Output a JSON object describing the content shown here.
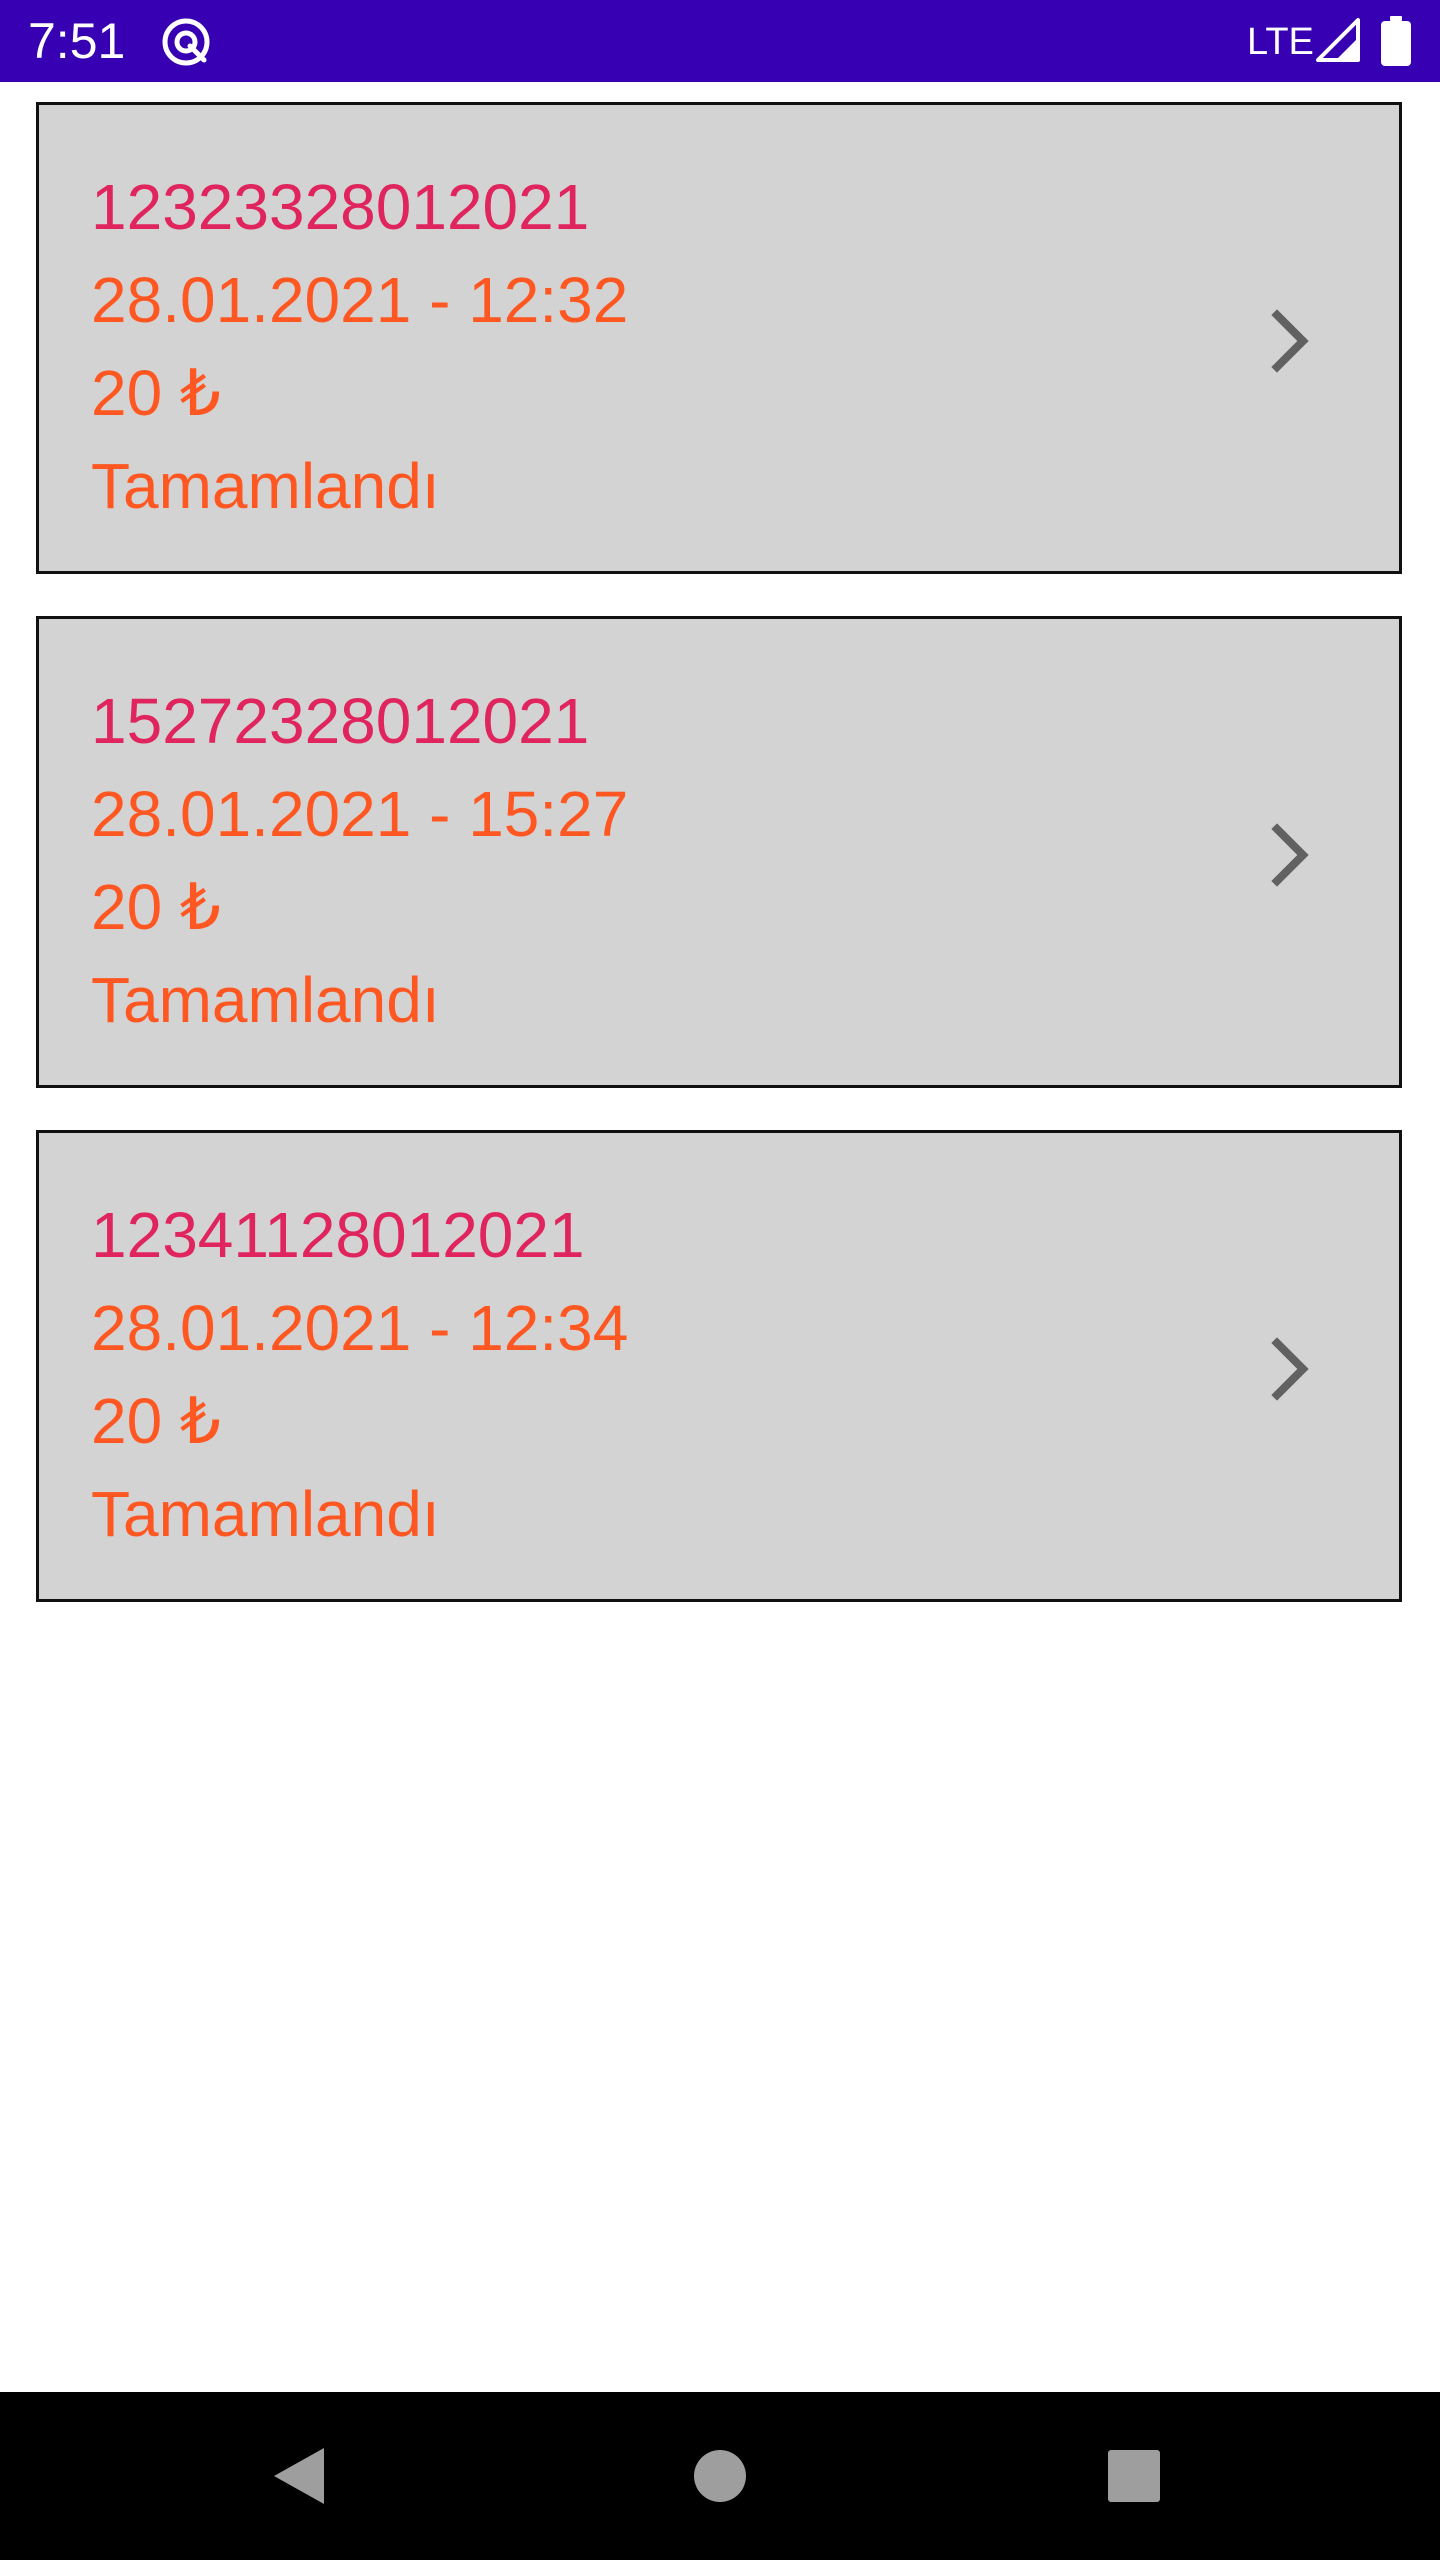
{
  "status_bar": {
    "time": "7:51",
    "network": "LTE",
    "background_color": "#3700b3",
    "icons": [
      "app-notification-icon",
      "signal-icon",
      "battery-icon"
    ]
  },
  "orders": [
    {
      "id": "12323328012021",
      "datetime": "28.01.2021 - 12:32",
      "amount": "20 ₺",
      "status": "Tamamlandı"
    },
    {
      "id": "15272328012021",
      "datetime": "28.01.2021 - 15:27",
      "amount": "20 ₺",
      "status": "Tamamlandı"
    },
    {
      "id": "12341128012021",
      "datetime": "28.01.2021 - 12:34",
      "amount": "20 ₺",
      "status": "Tamamlandı"
    }
  ],
  "colors": {
    "order_id": "#e0245e",
    "order_meta": "#ff5722",
    "card_background": "#d3d3d3",
    "card_border": "#111111",
    "chevron": "#616161"
  },
  "nav_bar": {
    "buttons": [
      "back-icon",
      "home-icon",
      "recents-icon"
    ]
  }
}
